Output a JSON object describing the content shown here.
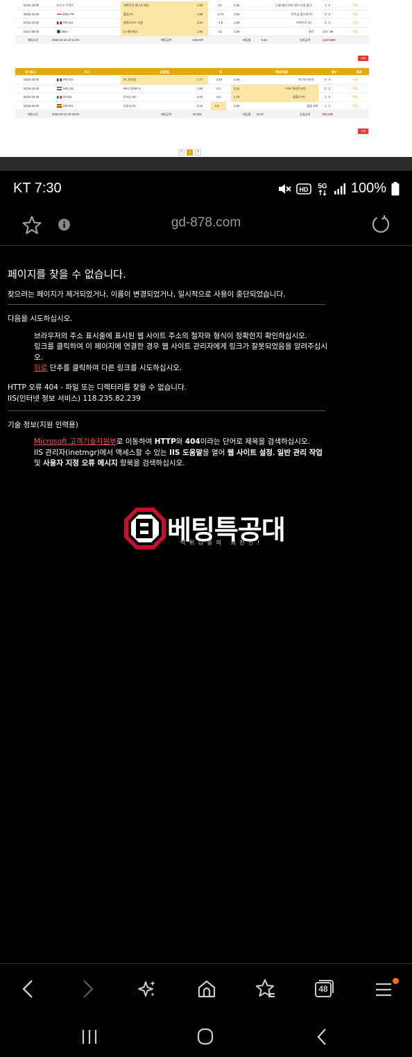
{
  "screenshot": {
    "table1": {
      "rows": [
        {
          "time": "03/16 23:00",
          "league": "파나소 아렌트",
          "pick": "대한민국 파나소 배당",
          "odd": "1.83",
          "mid": "VS",
          "odd2": "1.35",
          "away": "1.35 배당 마하 경기 조합 불가",
          "score": "1 : 0",
          "result": "적중"
        },
        {
          "time": "03/16 22:30",
          "league": "ENG PR",
          "pick": "풀럼 FC",
          "odd": "1.86",
          "mid": "3.75",
          "odd2": "3.66",
          "away": "토트넘 홋스퍼 FC",
          "score": "2 : 0",
          "result": "적중"
        },
        {
          "time": "03/16 23:00",
          "league": "FRA D1",
          "pick": "랭랭스타드 리옹",
          "odd": "1.54",
          "mid": "-1.5",
          "odd2": "1.86",
          "away": "르아브르 AC",
          "score": "4 : 2",
          "result": "적중"
        },
        {
          "time": "03/17 06:00",
          "league": "NBA",
          "pick": "LA 클리퍼스",
          "odd": "1.85",
          "mid": "-12",
          "odd2": "1.85",
          "away": "골든",
          "score": "123 : 88",
          "result": "적중"
        }
      ],
      "summary": {
        "label": "배팅시간",
        "time": "2025-03-16 22:14:28",
        "amount_label": "배팅금액",
        "amount": "630,000",
        "rate_label": "배당률",
        "rate": "6.52",
        "win_label": "당첨금액",
        "win": "4,107,600"
      },
      "delete_label": "삭제"
    },
    "table2": {
      "headers": [
        "경기일시",
        "리그",
        "승(홈팀)",
        "무",
        "패(원정팀)",
        "점수",
        "결과"
      ],
      "rows": [
        {
          "time": "03/16 04:00",
          "league": "FRA D2",
          "home": "FC 로리앙",
          "odd": "1.77",
          "mid": "3.53",
          "odd2": "4.46",
          "away": "SC 바스티아",
          "score": "4 : 0",
          "result": "적중"
        },
        {
          "time": "03/16 04:00",
          "league": "HOL D1",
          "home": "RKC 발베이크",
          "odd": "1.69",
          "mid": "3.3",
          "odd2": "2.01",
          "away": "PSV 에인트호번",
          "score": "0 : 3",
          "result": "적중"
        },
        {
          "time": "03/16 04:45",
          "league": "ITA D1",
          "home": "토리노 FC",
          "odd": "2.00",
          "mid": "2.5",
          "odd2": "1.78",
          "away": "엠폴리 FC",
          "score": "1 : 0",
          "result": "적중"
        },
        {
          "time": "03/16 05:00",
          "league": "SPA D1",
          "home": "지로나 FC",
          "odd": "2.02",
          "mid": "3.5",
          "odd2": "3.96",
          "away": "엠엠 사바",
          "score": "1 : 1",
          "result": "적중"
        }
      ],
      "summary": {
        "label": "배팅시간",
        "time": "2025-03-16 03:26:09",
        "amount_label": "배팅금액",
        "amount": "30,000",
        "rate_label": "배당률",
        "rate": "20.57",
        "win_label": "당첨금액",
        "win": "617,100"
      },
      "delete_label": "삭제"
    },
    "pager": {
      "prev": "<",
      "current": "1",
      "next": ">"
    }
  },
  "status_bar": {
    "carrier_time": "KT 7:30",
    "network": "5G",
    "hd": "HD",
    "battery": "100%"
  },
  "browser": {
    "url": "gd-878.com",
    "tab_count": "48"
  },
  "error_page": {
    "title": "페이지를 찾을 수 없습니다.",
    "description": "찾으려는 페이지가 제거되었거나, 이름이 변경되었거나, 일시적으로 사용이 중단되었습니다.",
    "try_label": "다음을 시도하십시오.",
    "tip1": "브라우저의 주소 표시줄에 표시된 웹 사이트 주소의 철자와 형식이 정확한지 확인하십시오.",
    "tip2": "링크를 클릭하여 이 페이지에 연결한 경우 웹 사이트 관리자에게 링크가 잘못되었음을 알려주십시오.",
    "back_link": "뒤로",
    "tip3_rest": " 단추를 클릭하여 다른 링크를 시도하십시오.",
    "http_error": "HTTP 오류 404 - 파일 또는 디렉터리를 찾을 수 없습니다.",
    "iis_info": "IIS(인터넷 정보 서비스) 118.235.82.239",
    "tech_label": "기술 정보(지원 인력용)",
    "ms_link": "Microsoft 고객기술지원부",
    "tech1_a": "로 이동하여 ",
    "tech1_b": "HTTP",
    "tech1_c": "와 ",
    "tech1_d": "404",
    "tech1_e": "이라는 단어로 제목을 검색하십시오.",
    "tech2_a": "IIS 관리자(inetmgr)에서 액세스할 수 있는 ",
    "tech2_b": "IIS 도움말",
    "tech2_c": "을 열어 ",
    "tech2_d": "웹 사이트 설정",
    "tech2_e": ", ",
    "tech2_f": "일반 관리 작업",
    "tech3_a": "및 ",
    "tech3_b": "사용자 지정 오류 메시지",
    "tech3_c": " 항목을 검색하십시오."
  },
  "logo": {
    "name": "베팅특공대",
    "slogan": "먹튀검증의 최전선!",
    "accent_color": "#c8102e"
  }
}
